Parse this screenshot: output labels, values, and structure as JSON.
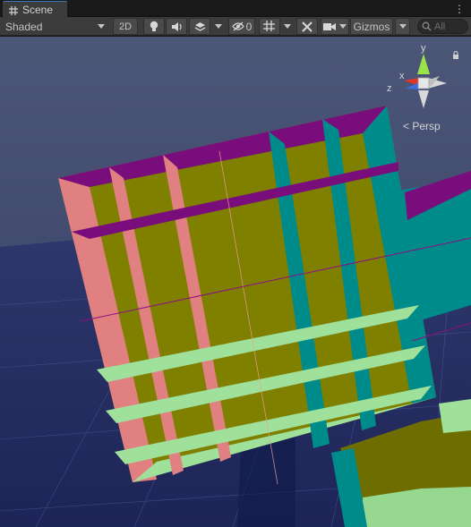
{
  "window": {
    "tab_label": "Scene",
    "tab_icon": "grid-icon",
    "menu_icon": "kebab-menu-icon"
  },
  "toolbar": {
    "draw_mode": "Shaded",
    "toggle_2d_label": "2D",
    "lighting_icon": "lightbulb-icon",
    "audio_icon": "speaker-icon",
    "effects_icon": "layers-icon",
    "hidden_icon": "eye-slash-icon",
    "hidden_count": "0",
    "grid_icon": "grid-snap-icon",
    "tools_icon": "crossed-tools-icon",
    "camera_icon": "camera-icon",
    "gizmos_label": "Gizmos",
    "search_placeholder": "All",
    "search_icon": "search-icon"
  },
  "viewport": {
    "projection_label": "Persp",
    "lock_icon": "lock-icon",
    "axis_y": "y",
    "axis_x": "x",
    "axis_z": "z",
    "colors": {
      "sky": "#3e4770",
      "ground": "#262f5e",
      "top_face": "#7a0d7c",
      "front_face": "#7f7f00",
      "left_face": "#e08080",
      "right_face": "#008b8b",
      "bottom_face": "#9fe09a",
      "axis_x": "#e0362a",
      "axis_y": "#9be34a",
      "axis_z": "#3a6fe0"
    }
  }
}
